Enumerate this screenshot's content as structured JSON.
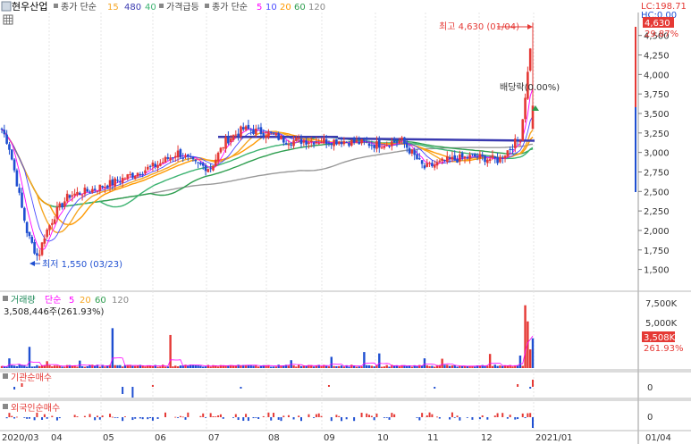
{
  "header": {
    "stock_name": "현우산업",
    "ma_label": "종가 단순",
    "ma_periods": [
      "15",
      "480",
      "40"
    ],
    "surge_label": "가격급등",
    "ma_label2": "종가 단순",
    "ma_periods2": [
      "5",
      "10",
      "20",
      "60",
      "120"
    ],
    "lc_label": "LC:198.71",
    "hc_label": "HC:0.00"
  },
  "price_panel": {
    "high_label": "최고 4,630 (01/04)",
    "low_label": "최저 1,550 (03/23)",
    "dividend_label": "배당락(0.00%)",
    "current_price_badge": "4,630",
    "current_change_badge": "29.87%",
    "y_ticks": [
      "4,500",
      "4,250",
      "4,000",
      "3,750",
      "3,500",
      "3,250",
      "3,000",
      "2,750",
      "2,500",
      "2,250",
      "2,000",
      "1,750",
      "1,500"
    ]
  },
  "volume_panel": {
    "title": "거래량",
    "ma_label": "단순",
    "ma_periods": [
      "5",
      "20",
      "60",
      "120"
    ],
    "value_label": "3,508,446주(261.93%)",
    "y_ticks": [
      "7,500K",
      "5,000K"
    ],
    "current_badge": "3,508K",
    "current_pct": "261.93%"
  },
  "inst_panel": {
    "title": "기관순매수",
    "zero_tick": "0"
  },
  "foreign_panel": {
    "title": "외국인순매수",
    "zero_tick": "0"
  },
  "x_axis": {
    "labels": [
      "2020/03",
      "04",
      "05",
      "06",
      "07",
      "08",
      "09",
      "10",
      "11",
      "12",
      "2021/01",
      "01/04"
    ]
  },
  "colors": {
    "up": "#e53935",
    "down": "#1f4fd1",
    "ma15": "#f5a623",
    "ma480": "#3a3ab0",
    "ma40": "#3cb371",
    "ma120": "#999999",
    "ma5": "#ff00ff",
    "ma10": "#4b4bff",
    "ma20": "#ff9900",
    "ma60": "#2e9e4f"
  },
  "chart_data": {
    "type": "candlestick",
    "ylim": [
      1400,
      4700
    ],
    "series_key": [
      {
        "x": "2020/03/02",
        "close": 3300
      },
      {
        "x": "2020/03/06",
        "close": 3100
      },
      {
        "x": "2020/03/10",
        "close": 2700
      },
      {
        "x": "2020/03/13",
        "close": 2350
      },
      {
        "x": "2020/03/17",
        "close": 1950
      },
      {
        "x": "2020/03/23",
        "close": 1650
      },
      {
        "x": "2020/03/27",
        "close": 1950
      },
      {
        "x": "2020/04/03",
        "close": 2250
      },
      {
        "x": "2020/04/10",
        "close": 2450
      },
      {
        "x": "2020/04/20",
        "close": 2500
      },
      {
        "x": "2020/05/04",
        "close": 2600
      },
      {
        "x": "2020/05/15",
        "close": 2700
      },
      {
        "x": "2020/06/01",
        "close": 2850
      },
      {
        "x": "2020/06/12",
        "close": 3000
      },
      {
        "x": "2020/06/22",
        "close": 2850
      },
      {
        "x": "2020/07/01",
        "close": 2800
      },
      {
        "x": "2020/07/10",
        "close": 3150
      },
      {
        "x": "2020/07/20",
        "close": 3300
      },
      {
        "x": "2020/08/03",
        "close": 3250
      },
      {
        "x": "2020/08/14",
        "close": 3150
      },
      {
        "x": "2020/09/01",
        "close": 3150
      },
      {
        "x": "2020/09/15",
        "close": 3150
      },
      {
        "x": "2020/10/05",
        "close": 3100
      },
      {
        "x": "2020/10/20",
        "close": 3150
      },
      {
        "x": "2020/11/02",
        "close": 2800
      },
      {
        "x": "2020/11/16",
        "close": 2900
      },
      {
        "x": "2020/12/01",
        "close": 2950
      },
      {
        "x": "2020/12/15",
        "close": 2900
      },
      {
        "x": "2020/12/28",
        "close": 3200
      },
      {
        "x": "2021/01/04",
        "close": 4630
      }
    ],
    "high": 4630,
    "low": 1550,
    "volume_latest": 3508446
  }
}
